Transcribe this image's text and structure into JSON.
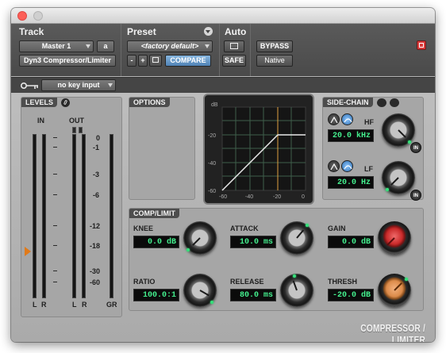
{
  "header": {
    "track_label": "Track",
    "preset_label": "Preset",
    "auto_label": "Auto",
    "track_name": "Master 1",
    "track_channel": "a",
    "insert_name": "Dyn3 Compressor/Limiter",
    "preset_name": "<factory default>",
    "minus": "-",
    "plus": "+",
    "compare": "COMPARE",
    "safe": "SAFE",
    "bypass": "BYPASS",
    "native": "Native"
  },
  "key": {
    "input": "no key input"
  },
  "levels": {
    "title": "LEVELS",
    "in": "IN",
    "out": "OUT",
    "scale": [
      "0",
      "-1",
      "-3",
      "-6",
      "-12",
      "-18",
      "-30",
      "-60"
    ],
    "bottom_l1": "L",
    "bottom_r1": "R",
    "bottom_l2": "L",
    "bottom_r2": "R",
    "bottom_gr": "GR"
  },
  "options": {
    "title": "OPTIONS"
  },
  "graph": {
    "db": "dB",
    "y_ticks": [
      "-20",
      "-40",
      "-60"
    ],
    "x_ticks": [
      "-60",
      "-40",
      "-20",
      "0"
    ]
  },
  "sidechain": {
    "title": "SIDE-CHAIN",
    "hf_label": "HF",
    "hf_value": "20.0 kHz",
    "lf_label": "LF",
    "lf_value": "20.0 Hz",
    "in1": "IN",
    "in2": "IN"
  },
  "comp": {
    "title": "COMP/LIMIT",
    "knee_label": "KNEE",
    "knee_value": "0.0 dB",
    "attack_label": "ATTACK",
    "attack_value": "10.0 ms",
    "gain_label": "GAIN",
    "gain_value": "0.0 dB",
    "ratio_label": "RATIO",
    "ratio_value": "100.0:1",
    "release_label": "RELEASE",
    "release_value": "80.0 ms",
    "thresh_label": "THRESH",
    "thresh_value": "-20.0 dB"
  },
  "footer": {
    "brand": "COMPRESSOR / LIMITER"
  },
  "colors": {
    "lcd_text": "#44f08e",
    "compare_button": "#5a8cc0",
    "gain_knob": "#c92a2a",
    "thresh_knob": "#dc8b4a",
    "close_button": "#fc5f57",
    "transfer_curve": "#e8e8e8",
    "threshold_marker": "#e0a040"
  },
  "icons": {
    "close": "close-icon",
    "key": "key-icon",
    "link": "link-icon",
    "listen": "listen-icon",
    "phase": "phase-icon",
    "filter": "filter-icon",
    "peak": "peak-marker-icon"
  }
}
